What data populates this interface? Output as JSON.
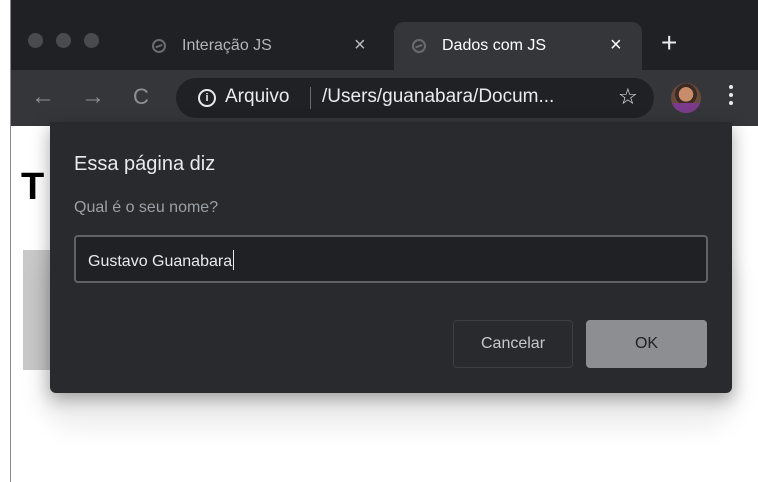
{
  "tabs": [
    {
      "title": "Interação JS",
      "close": "×"
    },
    {
      "title": "Dados com JS",
      "close": "×"
    }
  ],
  "new_tab": "+",
  "toolbar": {
    "back": "←",
    "forward": "→",
    "reload": "C",
    "info_glyph": "i",
    "secure_label": "Arquivo",
    "url": "/Users/guanabara/Docum...",
    "star": "☆"
  },
  "page": {
    "heading": "T"
  },
  "dialog": {
    "title": "Essa página diz",
    "message": "Qual é o seu nome?",
    "input_value": "Gustavo Guanabara",
    "cancel_label": "Cancelar",
    "ok_label": "OK"
  },
  "colors": {
    "chrome_dark": "#202124",
    "toolbar": "#35363a",
    "dialog_bg": "#292a2d",
    "ok_button": "#8d8e91"
  }
}
